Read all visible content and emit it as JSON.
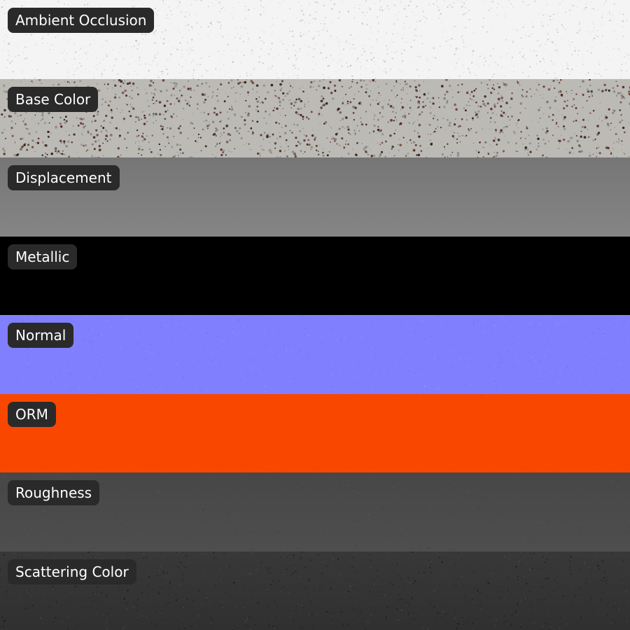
{
  "maps": [
    {
      "label": "Ambient Occlusion",
      "base_color": "#f4f4f4",
      "speckle": {
        "density": 1400,
        "colors": [
          "#c9c9c9",
          "#dadada",
          "#bdbdbd"
        ],
        "max_radius": 0.9
      },
      "gradient": null
    },
    {
      "label": "Base Color",
      "base_color": "#bcbab5",
      "speckle": {
        "density": 1600,
        "colors": [
          "#4a2418",
          "#5d2a1c",
          "#2f1a14",
          "#7a7570",
          "#8a857f"
        ],
        "max_radius": 1.6
      },
      "gradient": null
    },
    {
      "label": "Displacement",
      "base_color": "#7d7d7d",
      "speckle": null,
      "gradient": [
        "#767676",
        "#858585"
      ]
    },
    {
      "label": "Metallic",
      "base_color": "#000000",
      "speckle": null,
      "gradient": null
    },
    {
      "label": "Normal",
      "base_color": "#8080ff",
      "speckle": {
        "density": 1200,
        "colors": [
          "#7474f0",
          "#8c8cff",
          "#7a7af6"
        ],
        "max_radius": 0.9
      },
      "gradient": null
    },
    {
      "label": "ORM",
      "base_color": "#fa4700",
      "speckle": {
        "density": 500,
        "colors": [
          "#f04400",
          "#ff4d05"
        ],
        "max_radius": 0.8
      },
      "gradient": null
    },
    {
      "label": "Roughness",
      "base_color": "#4b4b4b",
      "speckle": {
        "density": 900,
        "colors": [
          "#555555",
          "#424242",
          "#505050"
        ],
        "max_radius": 0.8
      },
      "gradient": [
        "#474747",
        "#4e4e4e"
      ]
    },
    {
      "label": "Scattering Color",
      "base_color": "#353535",
      "speckle": {
        "density": 1100,
        "colors": [
          "#1e1e1e",
          "#282828",
          "#444444"
        ],
        "max_radius": 1.0
      },
      "gradient": [
        "#383838",
        "#303030"
      ]
    }
  ]
}
